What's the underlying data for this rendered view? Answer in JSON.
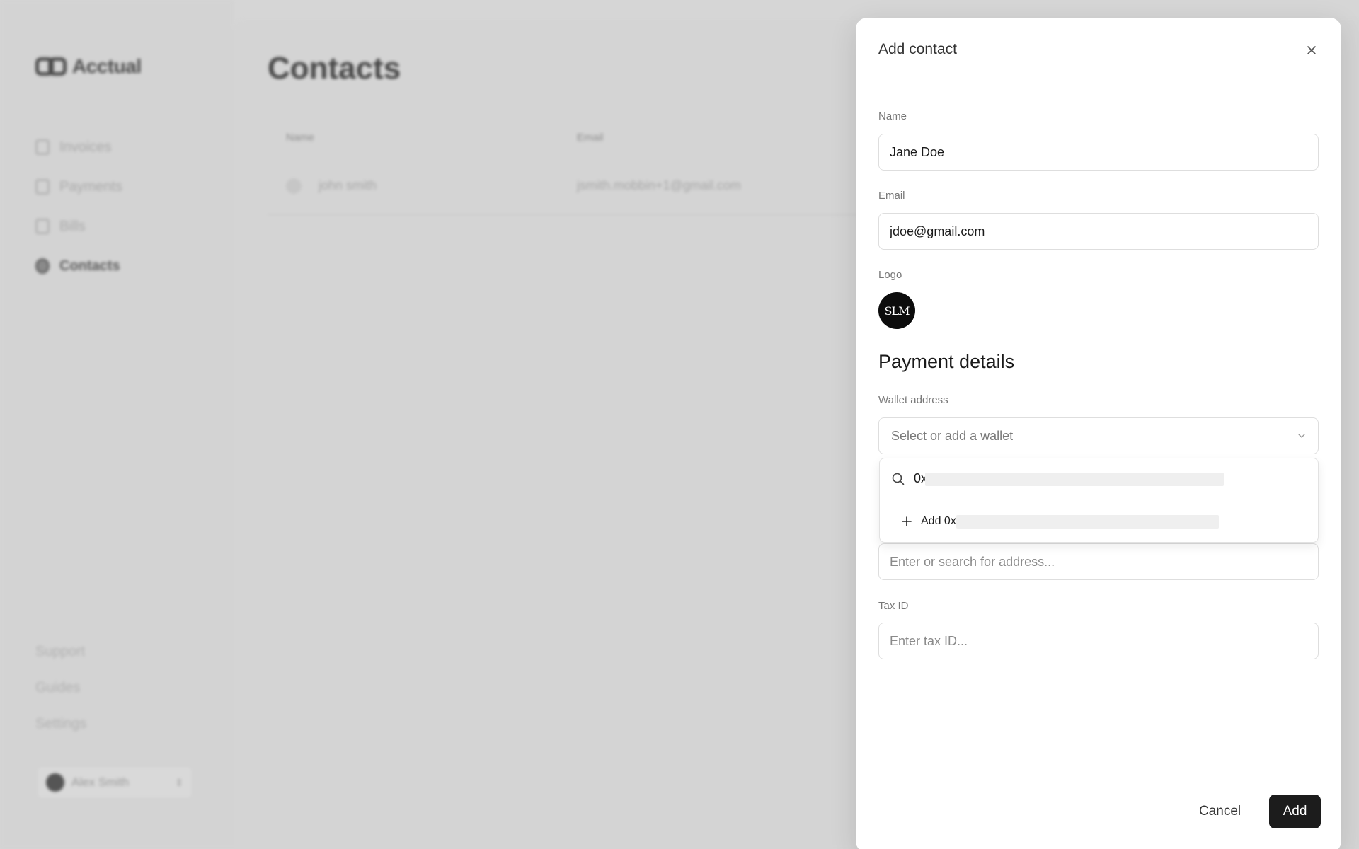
{
  "app": {
    "brand": "Acctual",
    "sidebar": {
      "items": [
        {
          "label": "Invoices",
          "icon": "invoice-icon"
        },
        {
          "label": "Payments",
          "icon": "chart-icon"
        },
        {
          "label": "Bills",
          "icon": "bill-icon"
        },
        {
          "label": "Contacts",
          "icon": "contacts-icon",
          "active": true
        }
      ],
      "bottom_links": [
        "Support",
        "Guides",
        "Settings"
      ],
      "user": {
        "name": "Alex Smith"
      }
    },
    "main": {
      "title": "Contacts",
      "table": {
        "headers": [
          "Name",
          "Email"
        ],
        "rows": [
          {
            "name": "john smith",
            "email": "jsmith.mobbin+1@gmail.com"
          }
        ]
      }
    }
  },
  "modal": {
    "title": "Add contact",
    "name": {
      "label": "Name",
      "value": "Jane Doe"
    },
    "email": {
      "label": "Email",
      "value": "jdoe@gmail.com"
    },
    "logo": {
      "label": "Logo",
      "initials": "SLM"
    },
    "payment_section": "Payment details",
    "wallet": {
      "label": "Wallet address",
      "placeholder": "Select or add a wallet",
      "dropdown": {
        "search_value": "0x",
        "add_option_prefix": "Add",
        "add_option_value": "0x"
      }
    },
    "address_input": {
      "placeholder": "Enter or search for address..."
    },
    "tax_id": {
      "label": "Tax ID",
      "placeholder": "Enter tax ID..."
    },
    "footer": {
      "cancel_label": "Cancel",
      "add_label": "Add"
    }
  },
  "colors": {
    "primary_button": "#1c1c1c",
    "overlay": "#d6d6d6",
    "modal_bg": "#ffffff"
  }
}
